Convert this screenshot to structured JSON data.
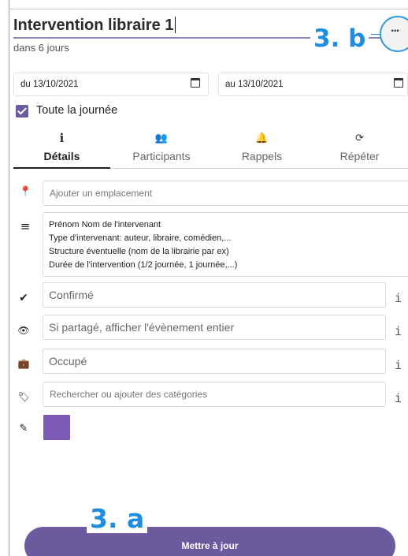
{
  "event": {
    "title": "Intervention libraire 1",
    "relative_date": "dans 6 jours",
    "more_label": "..."
  },
  "annotations": {
    "b": "3. b",
    "a": "3. a"
  },
  "dates": {
    "from": "du 13/10/2021",
    "to": "au 13/10/2021"
  },
  "all_day": {
    "label": "Toute la journée",
    "checked": true
  },
  "tabs": [
    {
      "label": "Détails",
      "icon": "info-icon",
      "glyph": "i",
      "active": true
    },
    {
      "label": "Participants",
      "icon": "people-icon",
      "glyph": "👥",
      "active": false
    },
    {
      "label": "Rappels",
      "icon": "bell-icon",
      "glyph": "🔔",
      "active": false
    },
    {
      "label": "Répéter",
      "icon": "repeat-icon",
      "glyph": "⟳",
      "active": false
    }
  ],
  "fields": {
    "location_placeholder": "Ajouter un emplacement",
    "description_lines": [
      "Prénom Nom de l'intervenant",
      "Type d'intervenant: auteur, libraire, comédien,...",
      "Structure éventuelle (nom de la librairie par ex)",
      "Durée de l'intervention (1/2 journée, 1 journée,...)"
    ],
    "status": "Confirmé",
    "sharing": "Si partagé, afficher l'évènement entier",
    "availability": "Occupé",
    "categories_placeholder": "Rechercher ou ajouter des catégories",
    "info_glyph": "i"
  },
  "color": "#7c5cb4",
  "accent_color": "#6b5a9d",
  "annotation_color": "#1f8ede",
  "update_button": "Mettre à jour"
}
